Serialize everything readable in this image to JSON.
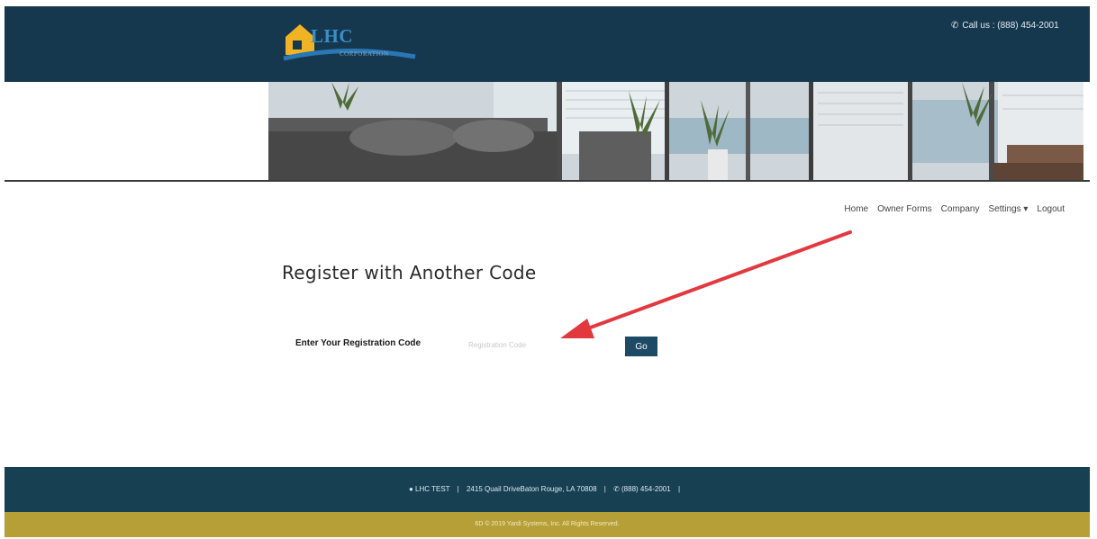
{
  "header": {
    "logo_word": "LHC",
    "logo_sub": "CORPORATION",
    "call_us": "Call us : (888) 454-2001",
    "colors": {
      "header_bg": "#16384f",
      "footer_bg": "#174053",
      "subfooter_bg": "#b79f38",
      "button_bg": "#1d4a64",
      "arrow": "#e2393f"
    }
  },
  "nav": {
    "items": [
      "Home",
      "Owner Forms",
      "Company",
      "Settings ▾",
      "Logout"
    ]
  },
  "main": {
    "title": "Register with Another Code",
    "reg_label": "Enter Your Registration Code",
    "reg_placeholder": "Registration Code",
    "go_label": "Go"
  },
  "footer": {
    "location": "LHC TEST",
    "address": "2415 Quail DriveBaton Rouge, LA 70808",
    "phone": "(888) 454-2001",
    "copyright": "6D © 2019 Yardi Systems, Inc. All Rights Reserved."
  },
  "icons": [
    "phone-icon",
    "map-marker-icon",
    "house-logo-icon",
    "annotation-arrow"
  ]
}
